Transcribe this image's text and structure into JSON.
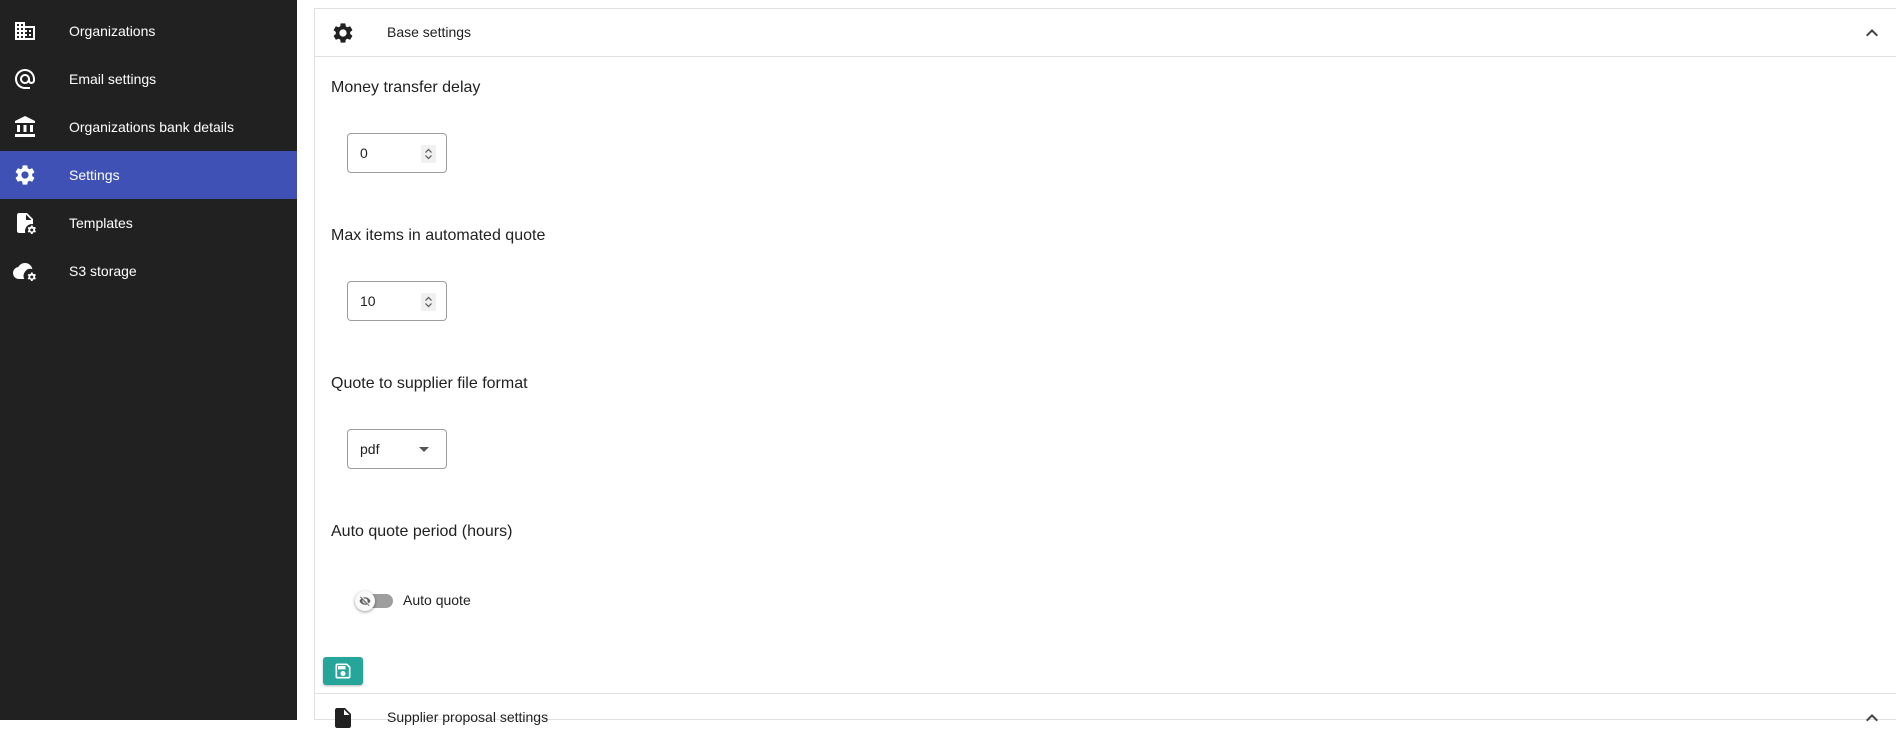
{
  "sidebar": {
    "items": [
      {
        "label": "Organizations",
        "icon": "building-icon",
        "active": false
      },
      {
        "label": "Email settings",
        "icon": "at-sign-icon",
        "active": false
      },
      {
        "label": "Organizations bank details",
        "icon": "bank-icon",
        "active": false
      },
      {
        "label": "Settings",
        "icon": "gear-icon",
        "active": true
      },
      {
        "label": "Templates",
        "icon": "file-cog-icon",
        "active": false
      },
      {
        "label": "S3 storage",
        "icon": "cloud-cog-icon",
        "active": false
      }
    ],
    "active_color": "#3f51b5",
    "background": "#212121"
  },
  "base_settings": {
    "title": "Base settings",
    "money_transfer_delay": {
      "label": "Money transfer delay",
      "value": "0"
    },
    "max_items": {
      "label": "Max items in automated quote",
      "value": "10"
    },
    "file_format": {
      "label": "Quote to supplier file format",
      "value": "pdf"
    },
    "auto_quote_period": {
      "label": "Auto quote period (hours)"
    },
    "auto_quote_toggle": {
      "label": "Auto quote",
      "enabled": false
    }
  },
  "supplier_proposal": {
    "title": "Supplier proposal settings"
  },
  "colors": {
    "save_button": "#26a69a"
  }
}
